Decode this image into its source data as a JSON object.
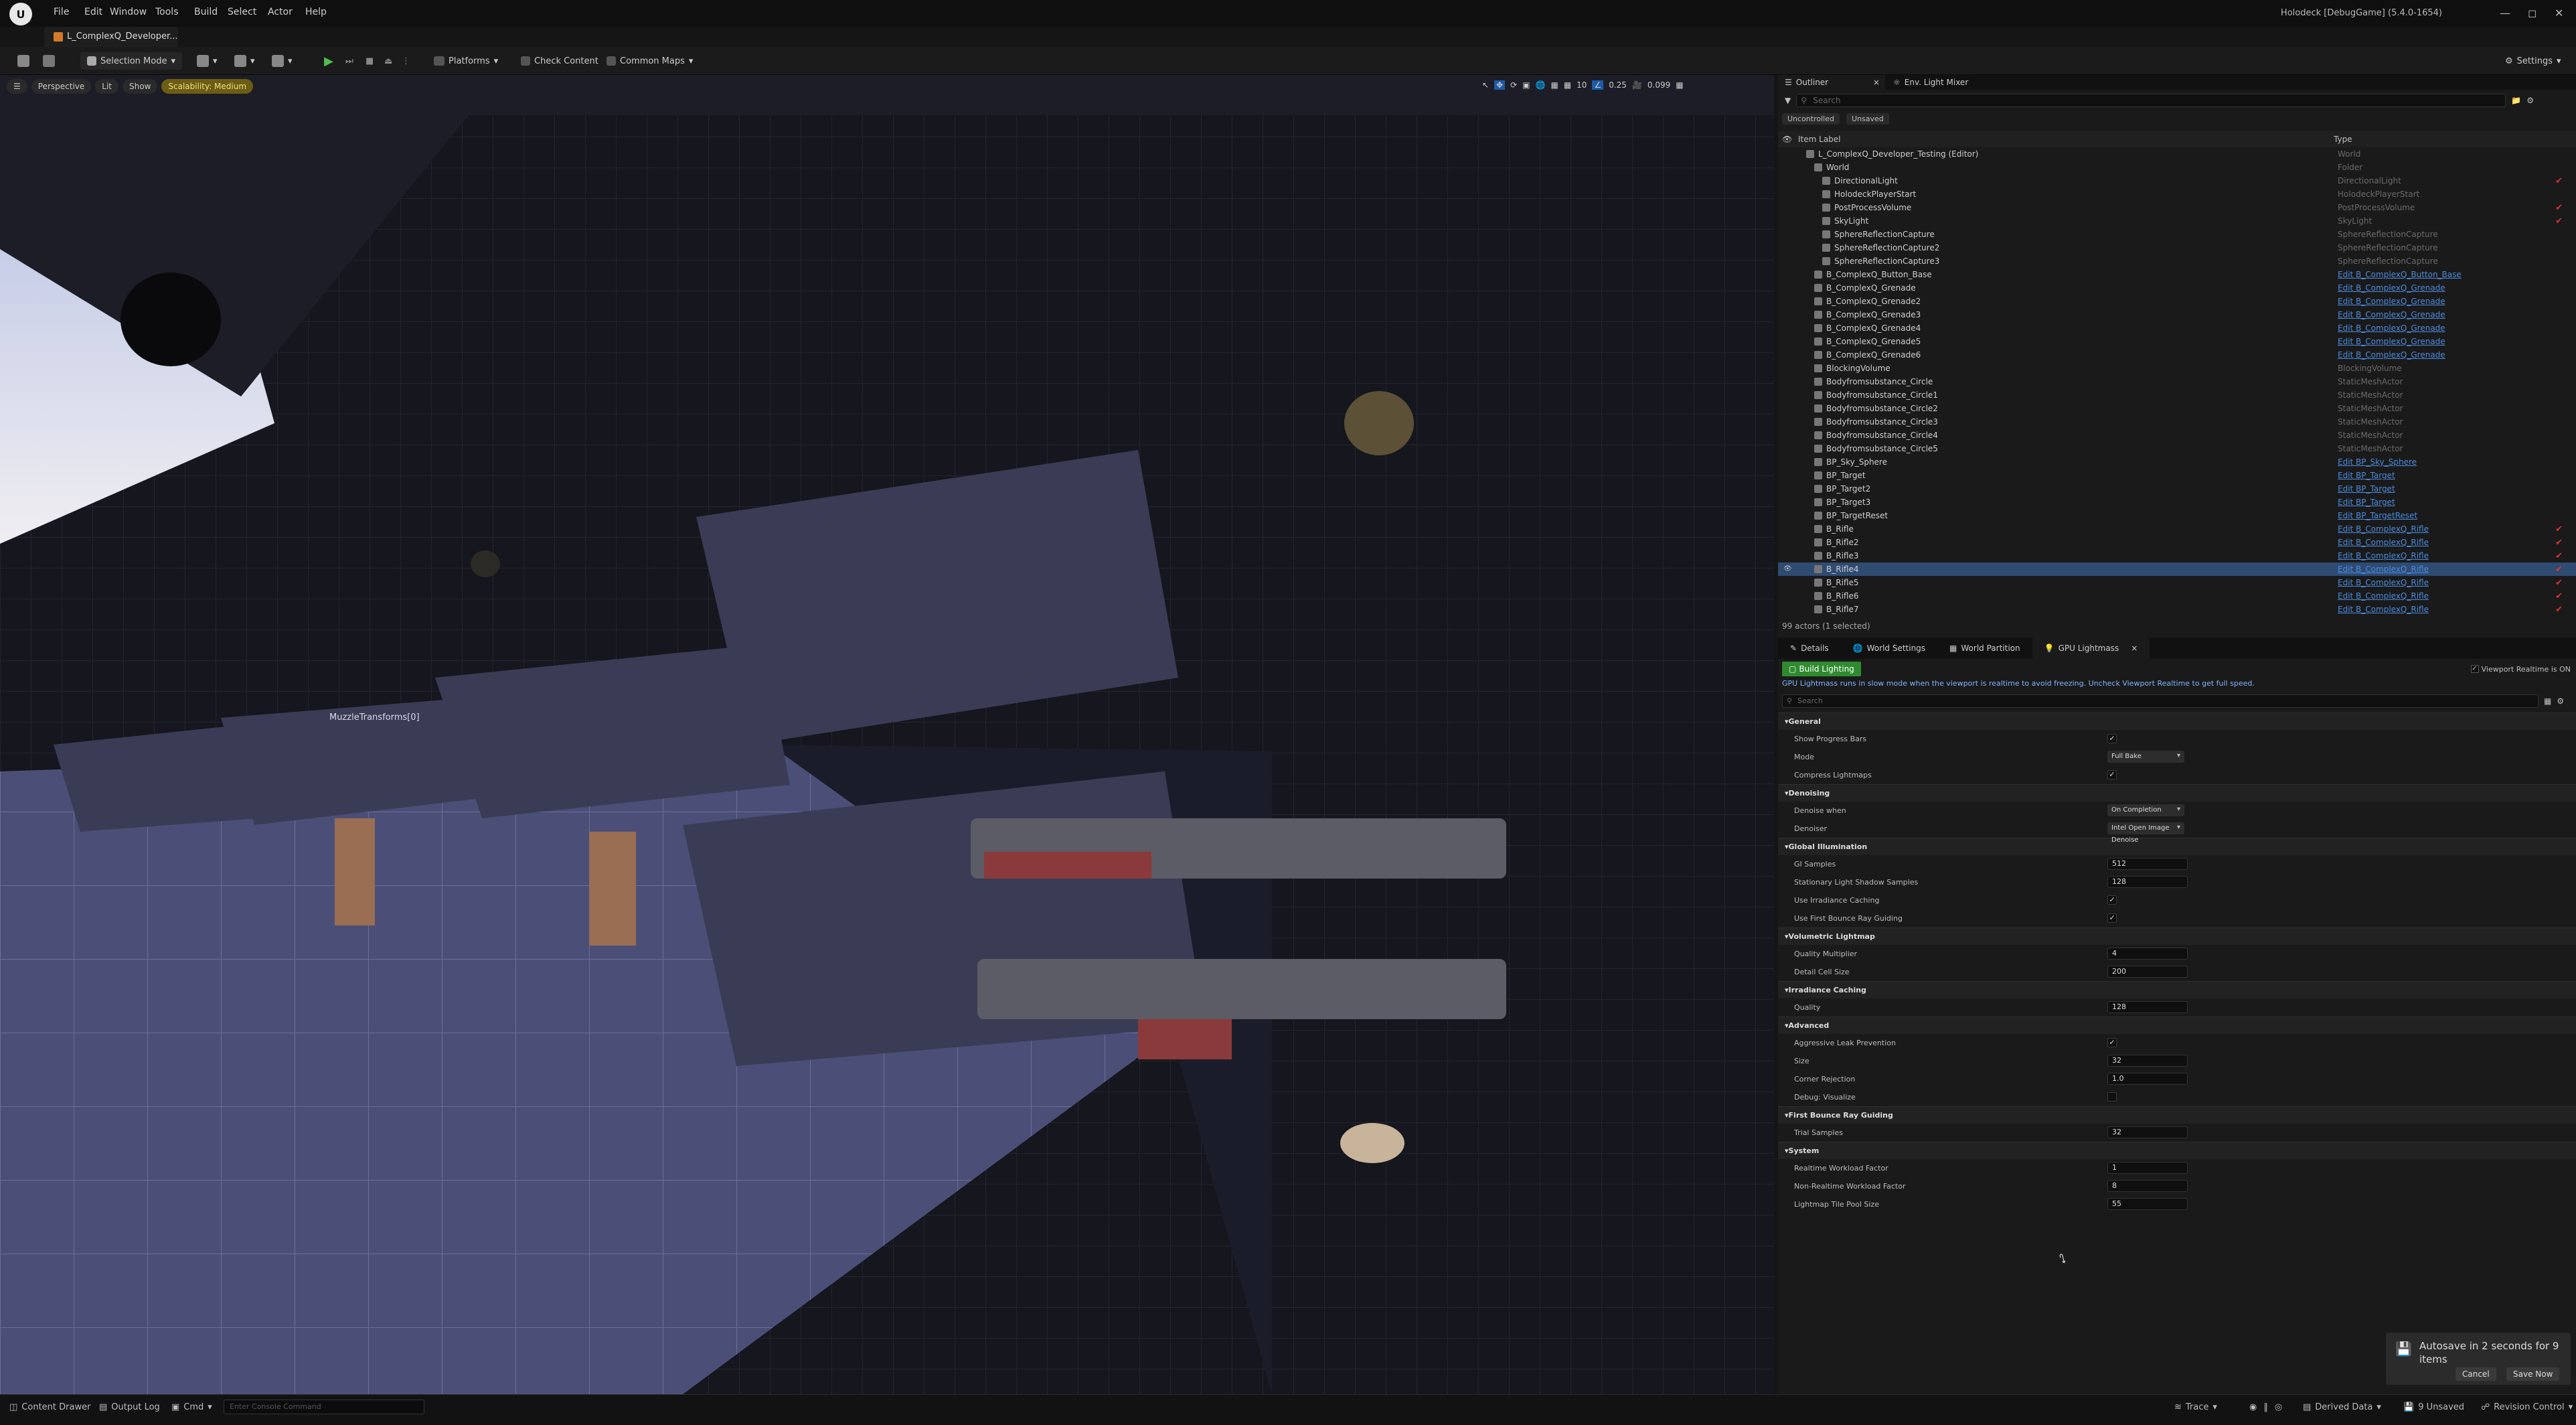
{
  "titlebar": {
    "menus": [
      "File",
      "Edit",
      "Window",
      "Tools",
      "Build",
      "Select",
      "Actor",
      "Help"
    ],
    "project_tab": "L_ComplexQ_Developer...",
    "window_title": "Holodeck [DebugGame] (5.4.0-1654)"
  },
  "toolbar": {
    "selection_mode": "Selection Mode",
    "platforms": "Platforms",
    "check_content": "Check Content",
    "common_maps": "Common Maps",
    "settings": "Settings"
  },
  "viewport": {
    "perspective": "Perspective",
    "lit": "Lit",
    "show": "Show",
    "scalability": "Scalability: Medium",
    "snap_angle": "10",
    "scale": "0.25",
    "camera_speed": "0.099",
    "actor_label": "MuzzleTransforms[0]"
  },
  "outliner": {
    "tab_outliner": "Outliner",
    "tab_mixer": "Env. Light Mixer",
    "search_placeholder": "Search",
    "filter_uncontrolled": "Uncontrolled",
    "filter_unsaved": "Unsaved",
    "col_label": "Item Label",
    "col_type": "Type",
    "rows": [
      {
        "label": "L_ComplexQ_Developer_Testing (Editor)",
        "type": "World",
        "indent": 1,
        "link": false,
        "check": false
      },
      {
        "label": "World",
        "type": "Folder",
        "indent": 2,
        "link": false,
        "check": false
      },
      {
        "label": "DirectionalLight",
        "type": "DirectionalLight",
        "indent": 3,
        "link": false,
        "check": true
      },
      {
        "label": "HolodeckPlayerStart",
        "type": "HolodeckPlayerStart",
        "indent": 3,
        "link": false,
        "check": false
      },
      {
        "label": "PostProcessVolume",
        "type": "PostProcessVolume",
        "indent": 3,
        "link": false,
        "check": true
      },
      {
        "label": "SkyLight",
        "type": "SkyLight",
        "indent": 3,
        "link": false,
        "check": true
      },
      {
        "label": "SphereReflectionCapture",
        "type": "SphereReflectionCapture",
        "indent": 3,
        "link": false,
        "check": false
      },
      {
        "label": "SphereReflectionCapture2",
        "type": "SphereReflectionCapture",
        "indent": 3,
        "link": false,
        "check": false
      },
      {
        "label": "SphereReflectionCapture3",
        "type": "SphereReflectionCapture",
        "indent": 3,
        "link": false,
        "check": false
      },
      {
        "label": "B_ComplexQ_Button_Base",
        "type": "Edit B_ComplexQ_Button_Base",
        "indent": 2,
        "link": true,
        "check": false
      },
      {
        "label": "B_ComplexQ_Grenade",
        "type": "Edit B_ComplexQ_Grenade",
        "indent": 2,
        "link": true,
        "check": false
      },
      {
        "label": "B_ComplexQ_Grenade2",
        "type": "Edit B_ComplexQ_Grenade",
        "indent": 2,
        "link": true,
        "check": false
      },
      {
        "label": "B_ComplexQ_Grenade3",
        "type": "Edit B_ComplexQ_Grenade",
        "indent": 2,
        "link": true,
        "check": false
      },
      {
        "label": "B_ComplexQ_Grenade4",
        "type": "Edit B_ComplexQ_Grenade",
        "indent": 2,
        "link": true,
        "check": false
      },
      {
        "label": "B_ComplexQ_Grenade5",
        "type": "Edit B_ComplexQ_Grenade",
        "indent": 2,
        "link": true,
        "check": false
      },
      {
        "label": "B_ComplexQ_Grenade6",
        "type": "Edit B_ComplexQ_Grenade",
        "indent": 2,
        "link": true,
        "check": false
      },
      {
        "label": "BlockingVolume",
        "type": "BlockingVolume",
        "indent": 2,
        "link": false,
        "check": false
      },
      {
        "label": "Bodyfromsubstance_Circle",
        "type": "StaticMeshActor",
        "indent": 2,
        "link": false,
        "check": false
      },
      {
        "label": "Bodyfromsubstance_Circle1",
        "type": "StaticMeshActor",
        "indent": 2,
        "link": false,
        "check": false
      },
      {
        "label": "Bodyfromsubstance_Circle2",
        "type": "StaticMeshActor",
        "indent": 2,
        "link": false,
        "check": false
      },
      {
        "label": "Bodyfromsubstance_Circle3",
        "type": "StaticMeshActor",
        "indent": 2,
        "link": false,
        "check": false
      },
      {
        "label": "Bodyfromsubstance_Circle4",
        "type": "StaticMeshActor",
        "indent": 2,
        "link": false,
        "check": false
      },
      {
        "label": "Bodyfromsubstance_Circle5",
        "type": "StaticMeshActor",
        "indent": 2,
        "link": false,
        "check": false
      },
      {
        "label": "BP_Sky_Sphere",
        "type": "Edit BP_Sky_Sphere",
        "indent": 2,
        "link": true,
        "check": false
      },
      {
        "label": "BP_Target",
        "type": "Edit BP_Target",
        "indent": 2,
        "link": true,
        "check": false
      },
      {
        "label": "BP_Target2",
        "type": "Edit BP_Target",
        "indent": 2,
        "link": true,
        "check": false
      },
      {
        "label": "BP_Target3",
        "type": "Edit BP_Target",
        "indent": 2,
        "link": true,
        "check": false
      },
      {
        "label": "BP_TargetReset",
        "type": "Edit BP_TargetReset",
        "indent": 2,
        "link": true,
        "check": false
      },
      {
        "label": "B_Rifle",
        "type": "Edit B_ComplexQ_Rifle",
        "indent": 2,
        "link": true,
        "check": true
      },
      {
        "label": "B_Rifle2",
        "type": "Edit B_ComplexQ_Rifle",
        "indent": 2,
        "link": true,
        "check": true
      },
      {
        "label": "B_Rifle3",
        "type": "Edit B_ComplexQ_Rifle",
        "indent": 2,
        "link": true,
        "check": true
      },
      {
        "label": "B_Rifle4",
        "type": "Edit B_ComplexQ_Rifle",
        "indent": 2,
        "link": true,
        "check": true,
        "selected": true
      },
      {
        "label": "B_Rifle5",
        "type": "Edit B_ComplexQ_Rifle",
        "indent": 2,
        "link": true,
        "check": true
      },
      {
        "label": "B_Rifle6",
        "type": "Edit B_ComplexQ_Rifle",
        "indent": 2,
        "link": true,
        "check": true
      },
      {
        "label": "B_Rifle7",
        "type": "Edit B_ComplexQ_Rifle",
        "indent": 2,
        "link": true,
        "check": true
      }
    ],
    "footer": "99 actors (1 selected)"
  },
  "details": {
    "tabs": [
      "Details",
      "World Settings",
      "World Partition",
      "GPU Lightmass"
    ],
    "build_lighting": "Build Lighting",
    "viewport_realtime": "Viewport Realtime is ON",
    "info": "GPU Lightmass runs in slow mode when the viewport is realtime to avoid freezing. Uncheck Viewport Realtime to get full speed.",
    "search_placeholder": "Search",
    "sections": [
      {
        "title": "General",
        "props": [
          {
            "label": "Show Progress Bars",
            "kind": "check",
            "value": "✓"
          },
          {
            "label": "Mode",
            "kind": "dropdown",
            "value": "Full Bake"
          },
          {
            "label": "Compress Lightmaps",
            "kind": "check",
            "value": "✓"
          }
        ]
      },
      {
        "title": "Denoising",
        "props": [
          {
            "label": "Denoise when",
            "kind": "dropdown",
            "value": "On Completion"
          },
          {
            "label": "Denoiser",
            "kind": "dropdown",
            "value": "Intel Open Image Denoise"
          }
        ]
      },
      {
        "title": "Global Illumination",
        "props": [
          {
            "label": "GI Samples",
            "kind": "num",
            "value": "512"
          },
          {
            "label": "Stationary Light Shadow Samples",
            "kind": "num",
            "value": "128"
          },
          {
            "label": "Use Irradiance Caching",
            "kind": "check",
            "value": "✓"
          },
          {
            "label": "Use First Bounce Ray Guiding",
            "kind": "check",
            "value": "✓"
          }
        ]
      },
      {
        "title": "Volumetric Lightmap",
        "props": [
          {
            "label": "Quality Multiplier",
            "kind": "num",
            "value": "4"
          },
          {
            "label": "Detail Cell Size",
            "kind": "num",
            "value": "200"
          }
        ]
      },
      {
        "title": "Irradiance Caching",
        "props": [
          {
            "label": "Quality",
            "kind": "num",
            "value": "128"
          }
        ]
      },
      {
        "title": "Advanced",
        "props": [
          {
            "label": "Aggressive Leak Prevention",
            "kind": "check",
            "value": "✓"
          },
          {
            "label": "Size",
            "kind": "num",
            "value": "32"
          },
          {
            "label": "Corner Rejection",
            "kind": "num",
            "value": "1.0"
          },
          {
            "label": "Debug: Visualize",
            "kind": "check",
            "value": ""
          }
        ]
      },
      {
        "title": "First Bounce Ray Guiding",
        "props": [
          {
            "label": "Trial Samples",
            "kind": "num",
            "value": "32"
          }
        ]
      },
      {
        "title": "System",
        "props": [
          {
            "label": "Realtime Workload Factor",
            "kind": "num",
            "value": "1"
          },
          {
            "label": "Non-Realtime Workload Factor",
            "kind": "num",
            "value": "8"
          },
          {
            "label": "Lightmap Tile Pool Size",
            "kind": "num",
            "value": "55"
          }
        ]
      }
    ]
  },
  "statusbar": {
    "content_drawer": "Content Drawer",
    "output_log": "Output Log",
    "cmd": "Cmd",
    "console_placeholder": "Enter Console Command",
    "trace": "Trace",
    "derived_data": "Derived Data",
    "unsaved": "9 Unsaved",
    "revision_control": "Revision Control"
  },
  "toast": {
    "message": "Autosave in 2 seconds for 9 items",
    "cancel": "Cancel",
    "save_now": "Save Now"
  }
}
